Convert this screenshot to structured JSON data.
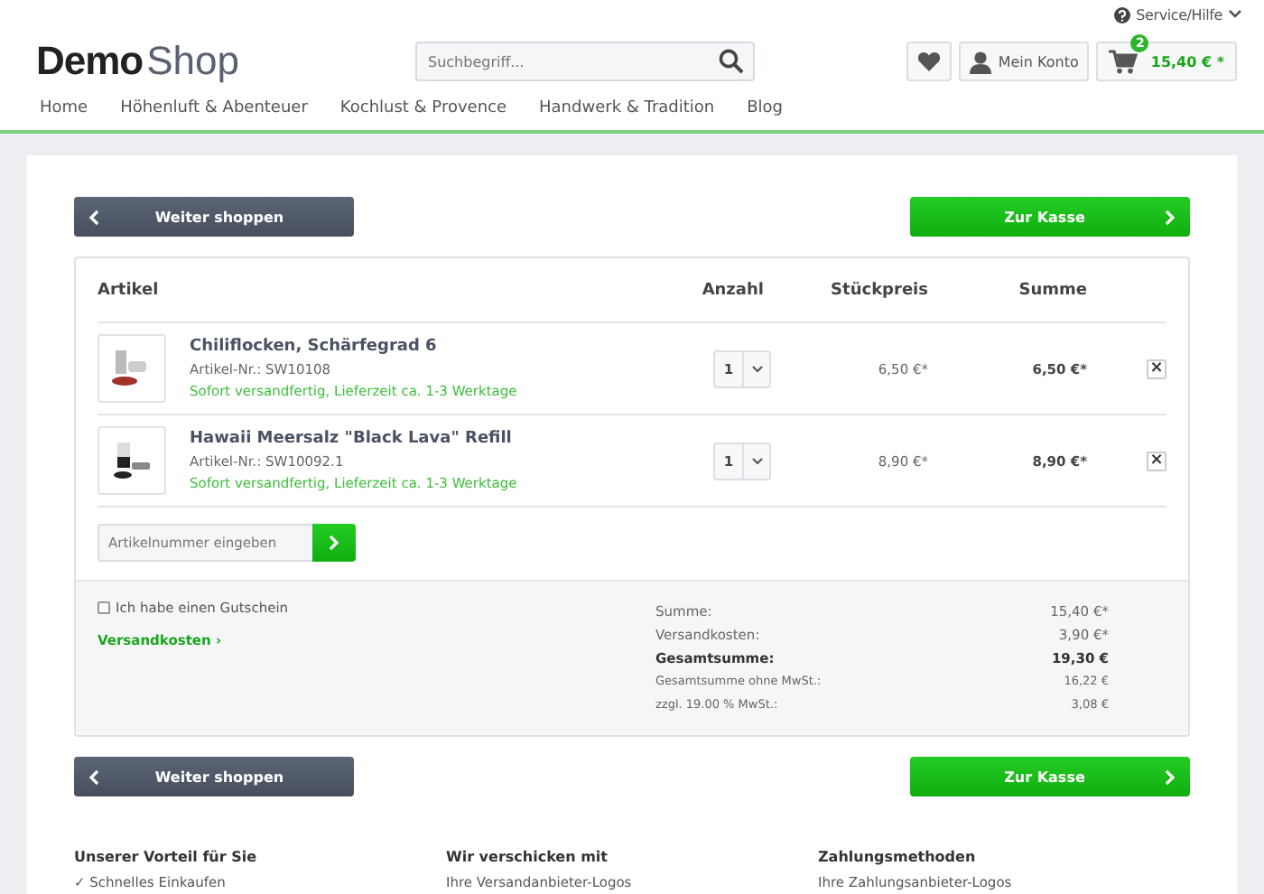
{
  "top_bar": {
    "service_link": "Service/Hilfe"
  },
  "logo": {
    "part_1": "Demo",
    "part_2": "Shop"
  },
  "search": {
    "placeholder": "Suchbegriff..."
  },
  "account": {
    "label": "Mein Konto"
  },
  "cart": {
    "count": "2",
    "total": "15,40 € *"
  },
  "nav": [
    {
      "label": "Home",
      "selected": false
    },
    {
      "label": "Höhenluft & Abenteuer",
      "selected": false
    },
    {
      "label": "Kochlust & Provence",
      "selected": false
    },
    {
      "label": "Handwerk & Tradition",
      "selected": false
    },
    {
      "label": "Blog",
      "selected": false
    }
  ],
  "actions_top": {
    "continue": "Weiter shoppen",
    "checkout": "Zur Kasse"
  },
  "table": {
    "columns": [
      "Artikel",
      "Anzahl",
      "Stückpreis",
      "Summe"
    ],
    "rows": [
      {
        "name": "Chiliflocken, Schärfegrad 6",
        "number": "Artikel-Nr.: SW10108",
        "delivery": "Sofort versandfertig, Lieferzeit ca. 1-3 Werktage",
        "quantity": "1",
        "unit_price": "6,50 €*",
        "sum": "6,50 €*",
        "remove": "×"
      },
      {
        "name": "Hawaii Meersalz \"Black Lava\" Refill",
        "number": "Artikel-Nr.: SW10092.1",
        "delivery": "Sofort versandfertig, Lieferzeit ca. 1-3 Werktage",
        "quantity": "1",
        "unit_price": "8,90 €*",
        "sum": "8,90 €*",
        "remove": "×"
      }
    ]
  },
  "add_article": {
    "placeholder": "Artikelnummer eingeben"
  },
  "voucher": {
    "label": "Ich habe einen Gutschein",
    "checked": false
  },
  "shipping_link": "Versandkosten ›",
  "summary": [
    {
      "kind": "normal",
      "label": "Summe:",
      "value": "15,40 €*"
    },
    {
      "kind": "normal",
      "label": "Versandkosten:",
      "value": "3,90 €*"
    },
    {
      "kind": "total",
      "label": "Gesamtsumme:",
      "value": "19,30 €"
    },
    {
      "kind": "small",
      "label": "Gesamtsumme ohne MwSt.:",
      "value": "16,22 €"
    },
    {
      "kind": "small",
      "label": "zzgl. 19.00 % MwSt.:",
      "value": "3,08 €"
    }
  ],
  "actions_bottom": {
    "continue": "Weiter shoppen",
    "checkout": "Zur Kasse"
  },
  "footer": [
    {
      "heading": "Unserer Vorteil für Sie",
      "item": "✓ Schnelles Einkaufen"
    },
    {
      "heading": "Wir verschicken mit",
      "item": "Ihre Versandanbieter-Logos"
    },
    {
      "heading": "Zahlungsmethoden",
      "item": "Ihre Zahlungsanbieter-Logos"
    }
  ]
}
